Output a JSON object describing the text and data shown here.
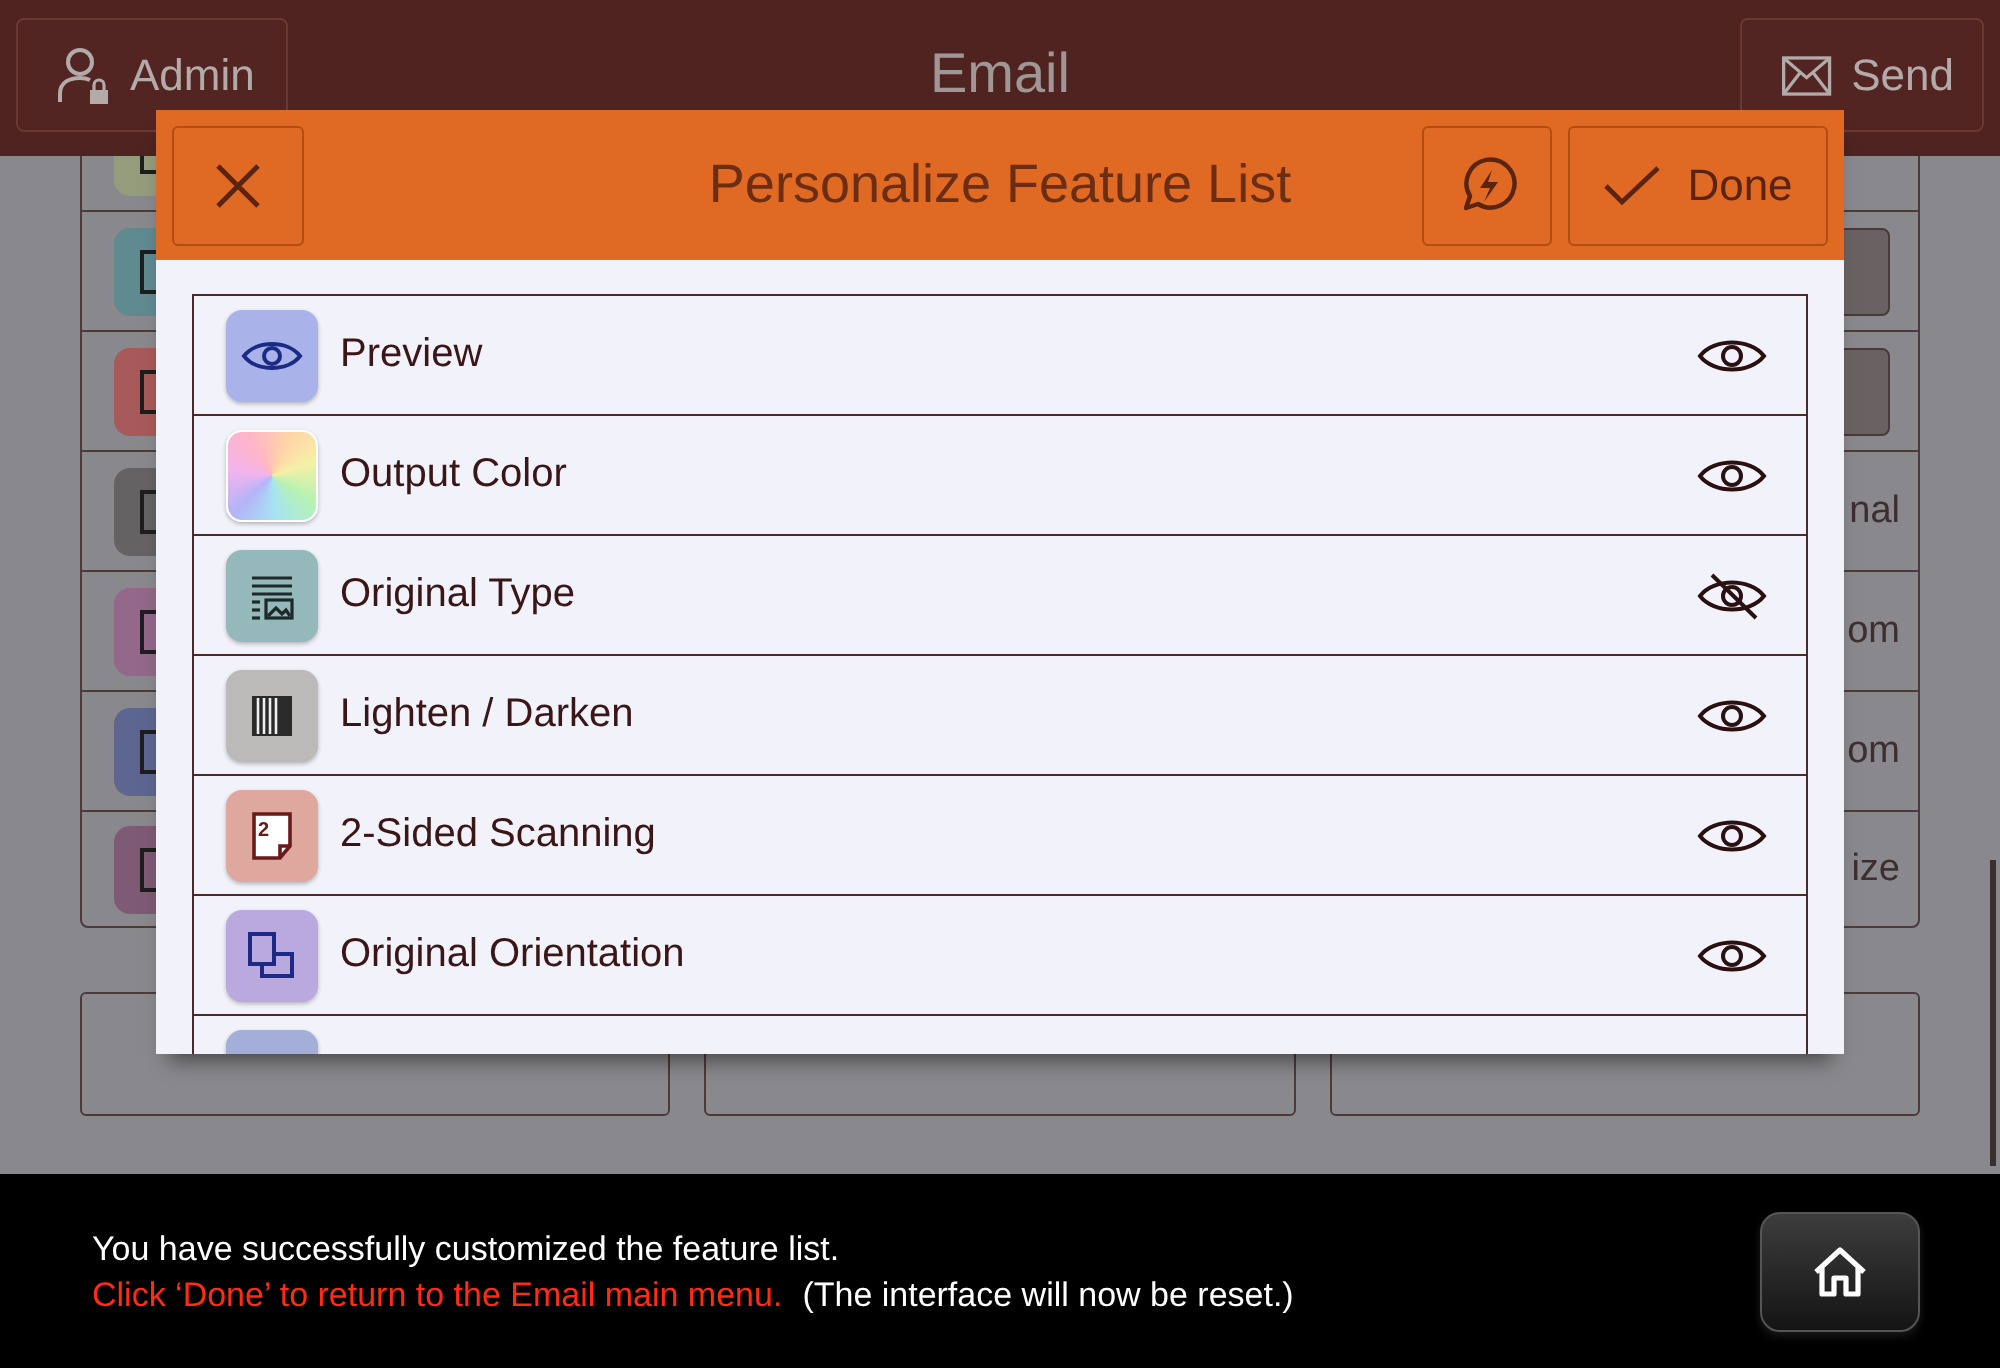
{
  "app_bar": {
    "admin_button": "Admin",
    "title": "Email",
    "send_button": "Send"
  },
  "background_list": {
    "rows": [
      {
        "kind": "blank",
        "color": "#949c7c"
      },
      {
        "kind": "control",
        "color": "#5f8a90"
      },
      {
        "kind": "control",
        "color": "#a85a5a"
      },
      {
        "kind": "text",
        "color": "#646262",
        "text": "nal"
      },
      {
        "kind": "text",
        "color": "#93688a",
        "text": "om"
      },
      {
        "kind": "text",
        "color": "#5c6690",
        "text": "om"
      },
      {
        "kind": "text",
        "color": "#7e5a74",
        "text": "ize"
      }
    ]
  },
  "dialog": {
    "title": "Personalize Feature List",
    "done_button": "Done",
    "features": [
      {
        "label": "Preview",
        "color": "#a9b3ea",
        "visible": true
      },
      {
        "label": "Output Color",
        "visible": true
      },
      {
        "label": "Original Type",
        "color": "#95b9ba",
        "visible": false
      },
      {
        "label": "Lighten / Darken",
        "color": "#bcb9b9",
        "visible": true
      },
      {
        "label": "2-Sided Scanning",
        "color": "#dfa89f",
        "badge": "2",
        "visible": true
      },
      {
        "label": "Original Orientation",
        "color": "#b9a9de",
        "visible": true
      },
      {
        "color": "#a3aed9"
      }
    ]
  },
  "message": {
    "line_1": "You have successfully customized the feature list.",
    "instruction": "Click ‘Done’ to return to the Email main menu.",
    "note": "(The interface will now be reset.)"
  }
}
